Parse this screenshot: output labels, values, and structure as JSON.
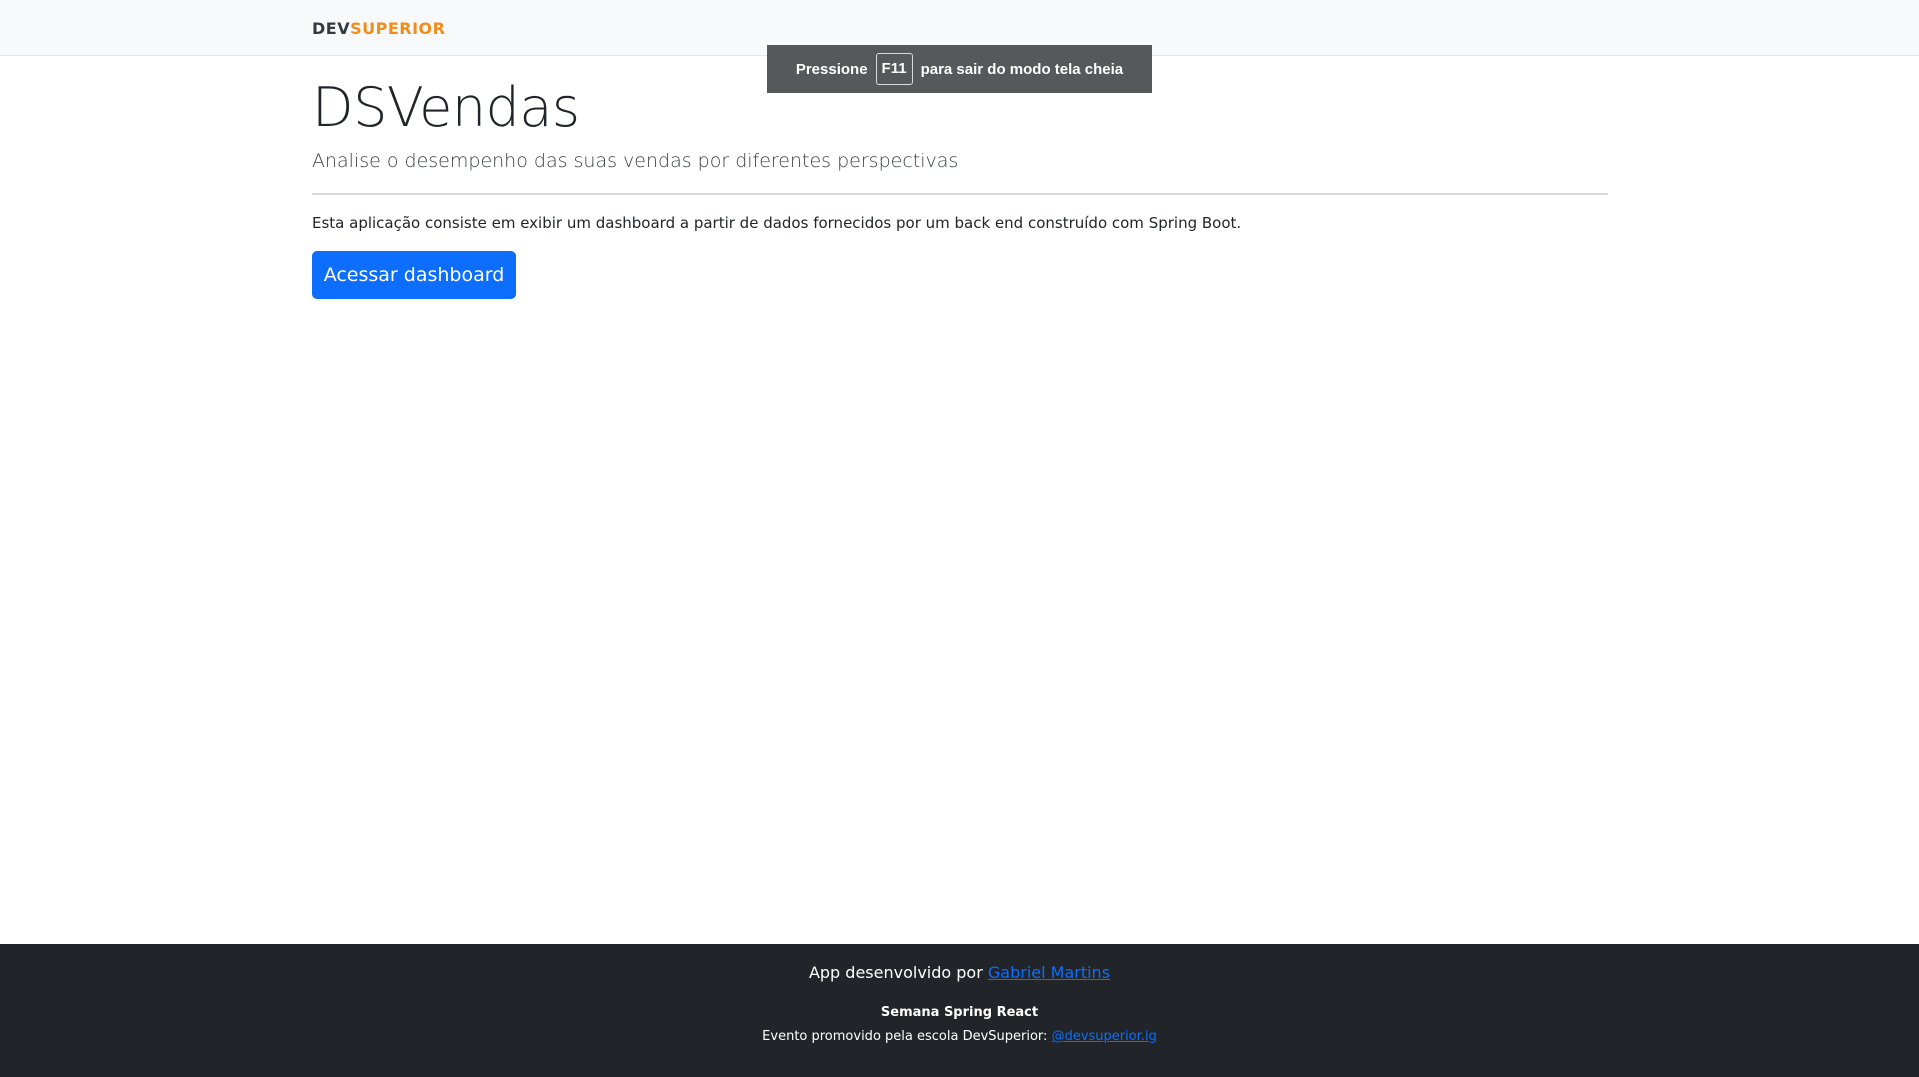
{
  "navbar": {
    "brand_dev": "DEV",
    "brand_superior": "SUPERIOR",
    "brand_colors": {
      "dev": "#343a40",
      "superior": "#f28c1a"
    }
  },
  "fullscreen_notice": {
    "prefix": "Pressione",
    "key": "F11",
    "suffix": "para sair do modo tela cheia"
  },
  "main": {
    "title": "DSVendas",
    "lead": "Analise o desempenho das suas vendas por diferentes perspectivas",
    "description": "Esta aplicação consiste em exibir um dashboard a partir de dados fornecidos por um back end construído com Spring Boot.",
    "button_label": "Acessar dashboard",
    "button_color": "#0d6efd"
  },
  "footer": {
    "dev_prefix": "App desenvolvido por",
    "dev_name": "Gabriel Martins",
    "event_title": "Semana Spring React",
    "event_prefix": "Evento promovido pela escola DevSuperior:",
    "event_handle": "@devsuperior.ig",
    "background": "#212529"
  }
}
